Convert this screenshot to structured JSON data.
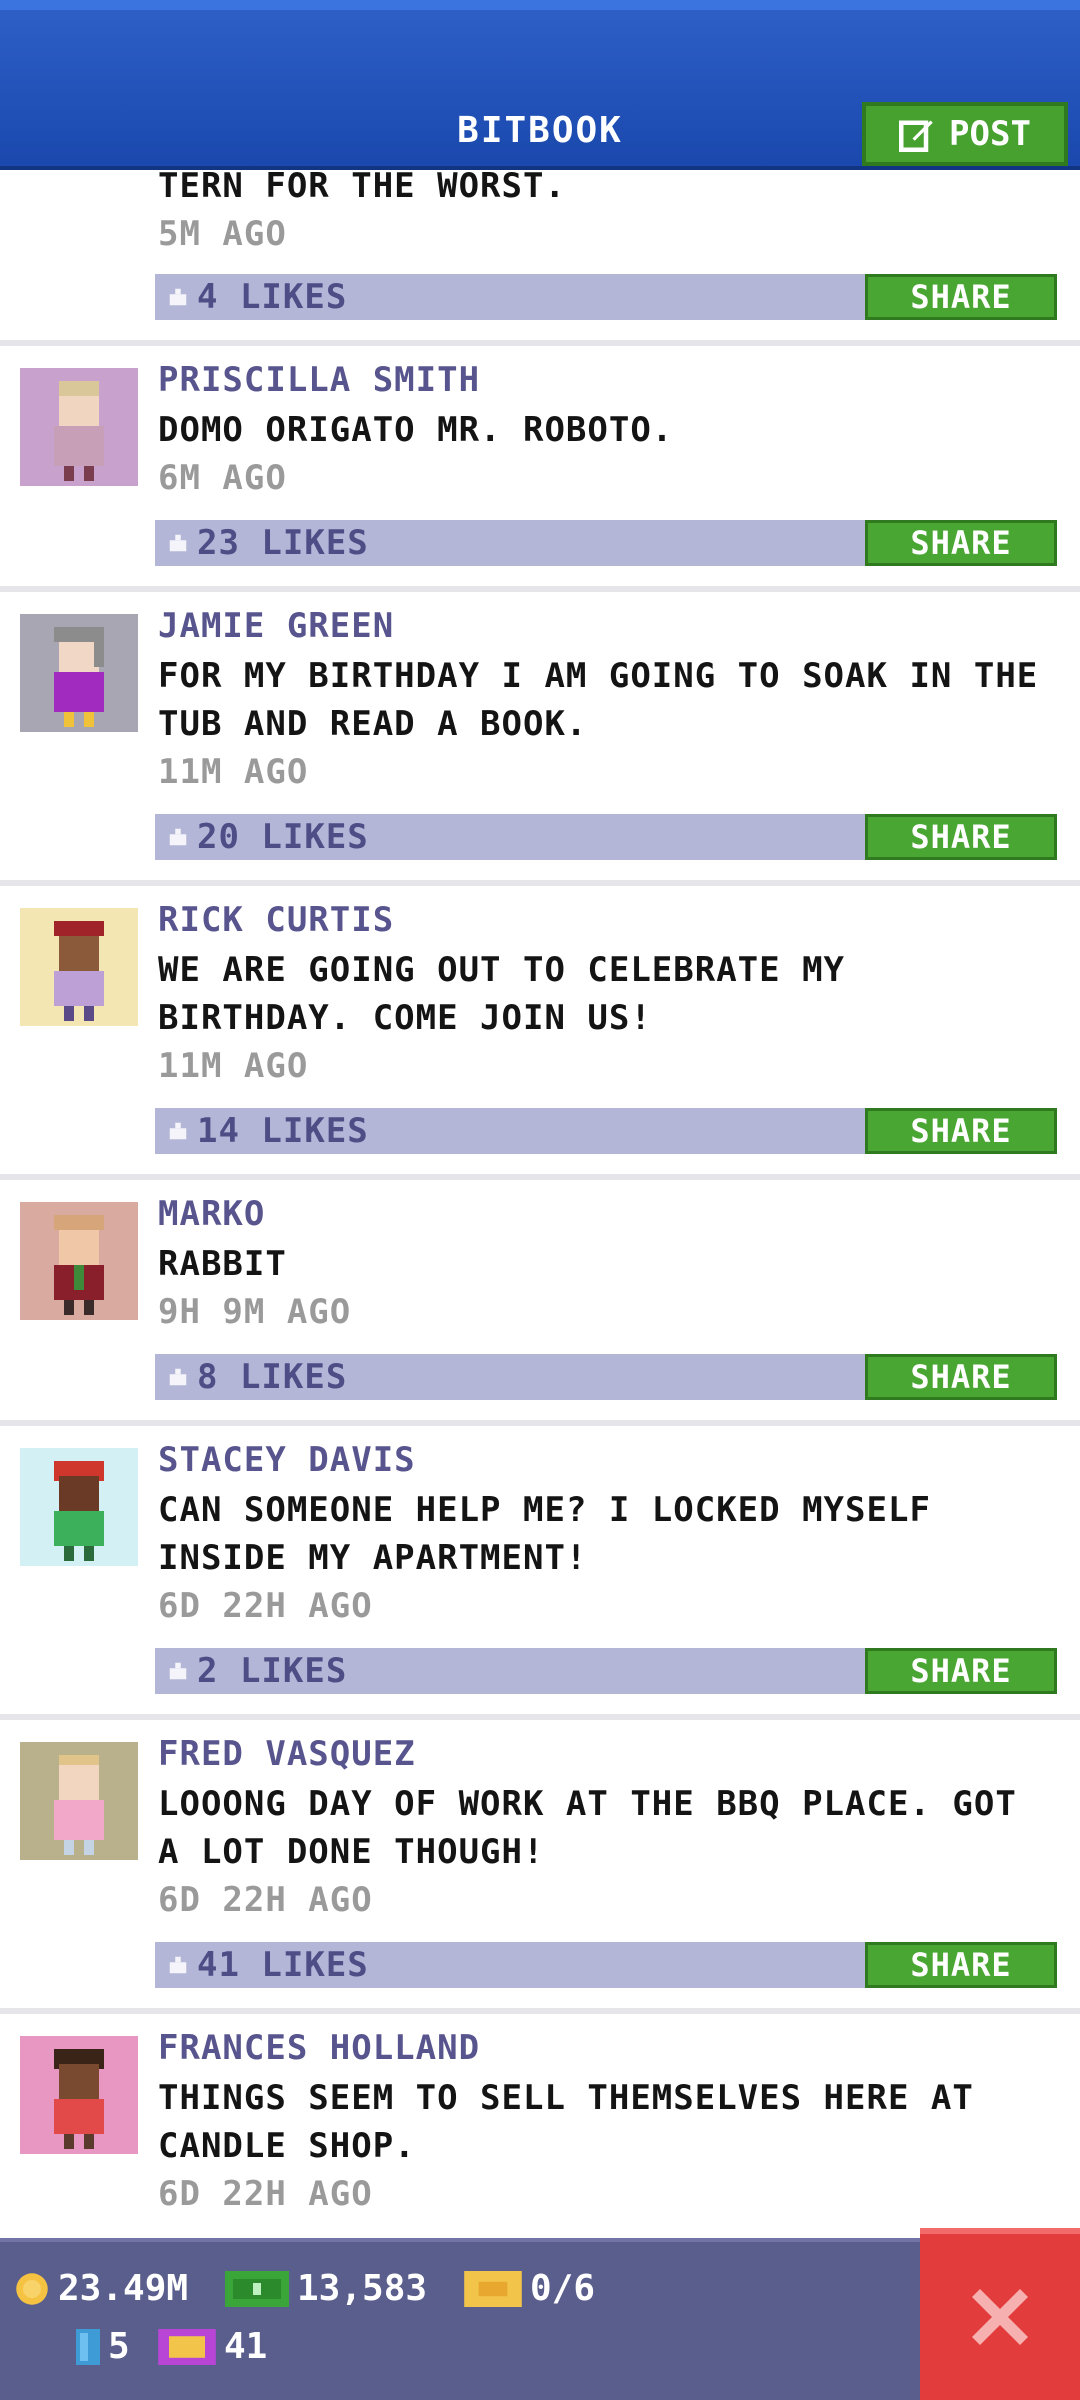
{
  "header": {
    "title": "BITBOOK",
    "post_label": "POST"
  },
  "partial_top": {
    "message": "TERN FOR THE WORST.",
    "time": "5M AGO",
    "likes": "4 LIKES",
    "share": "SHARE"
  },
  "posts": [
    {
      "author": "PRISCILLA SMITH",
      "message": "DOMO ORIGATO MR. ROBOTO.",
      "time": "6M AGO",
      "likes": "23 LIKES",
      "share": "SHARE"
    },
    {
      "author": "JAMIE GREEN",
      "message": "FOR MY BIRTHDAY I AM GOING TO SOAK IN THE TUB AND READ A BOOK.",
      "time": "11M AGO",
      "likes": "20 LIKES",
      "share": "SHARE"
    },
    {
      "author": "RICK CURTIS",
      "message": "WE ARE GOING OUT TO CELEBRATE MY BIRTHDAY. COME JOIN US!",
      "time": "11M AGO",
      "likes": "14 LIKES",
      "share": "SHARE"
    },
    {
      "author": "MARKO",
      "message": "RABBIT",
      "time": "9H 9M AGO",
      "likes": "8 LIKES",
      "share": "SHARE"
    },
    {
      "author": "STACEY DAVIS",
      "message": "CAN SOMEONE HELP ME? I LOCKED MYSELF INSIDE MY APARTMENT!",
      "time": "6D 22H AGO",
      "likes": "2 LIKES",
      "share": "SHARE"
    },
    {
      "author": "FRED VASQUEZ",
      "message": "LOOONG DAY OF WORK AT THE BBQ PLACE. GOT A LOT DONE THOUGH!",
      "time": "6D 22H AGO",
      "likes": "41 LIKES",
      "share": "SHARE"
    },
    {
      "author": "FRANCES HOLLAND",
      "message": "THINGS SEEM TO SELL THEMSELVES HERE AT CANDLE SHOP.",
      "time": "6D 22H AGO"
    }
  ],
  "status": {
    "coins": "23.49M",
    "bux": "13,583",
    "tickets": "0/6",
    "keys": "5",
    "vip": "41"
  },
  "colors": {
    "header": "#1a48ad",
    "share": "#4aa632",
    "likebar": "#b4b6d8",
    "close": "#e23c3c"
  }
}
